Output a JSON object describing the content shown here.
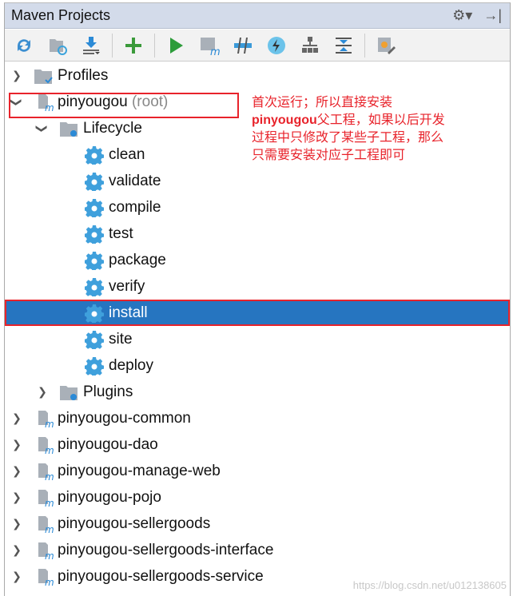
{
  "header": {
    "title": "Maven Projects"
  },
  "toolbar": [
    "reimport-icon",
    "generate-sources-icon",
    "download-icon",
    "add-icon",
    "run-icon",
    "execute-goal-icon",
    "toggle-offline-icon",
    "skip-tests-icon",
    "show-dependencies-icon",
    "collapse-all-icon",
    "settings-icon"
  ],
  "tree": {
    "profiles": "Profiles",
    "root": "pinyougou",
    "root_suffix": "(root)",
    "lifecycle": "Lifecycle",
    "goals": [
      "clean",
      "validate",
      "compile",
      "test",
      "package",
      "verify",
      "install",
      "site",
      "deploy"
    ],
    "selected_goal": "install",
    "plugins": "Plugins",
    "modules": [
      "pinyougou-common",
      "pinyougou-dao",
      "pinyougou-manage-web",
      "pinyougou-pojo",
      "pinyougou-sellergoods",
      "pinyougou-sellergoods-interface",
      "pinyougou-sellergoods-service"
    ]
  },
  "annotation": {
    "line1": "首次运行；所以直接安装",
    "bold": "pinyougou",
    "line2": "父工程，如果以后开发",
    "line3": "过程中只修改了某些子工程，那么",
    "line4": "只需要安装对应子工程即可"
  },
  "watermark": "https://blog.csdn.net/u012138605"
}
